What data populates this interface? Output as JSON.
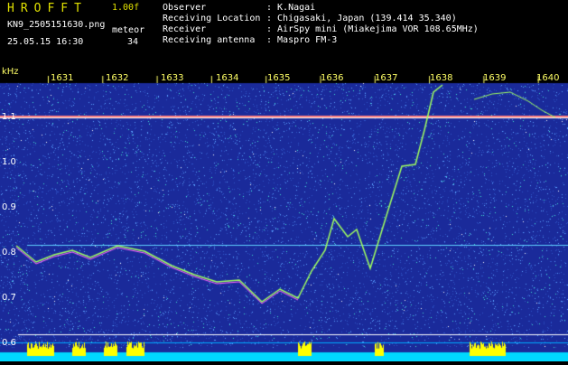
{
  "header": {
    "logo": "HROFFT",
    "version": "1.00f",
    "filename": "KN9_2505151630.png",
    "datetime": "25.05.15 16:30",
    "meteor_label": "meteor",
    "meteor_count": "34",
    "fields": [
      {
        "label": "Observer",
        "value": ": K.Nagai"
      },
      {
        "label": "Receiving Location",
        "value": ": Chigasaki, Japan (139.414 35.340)"
      },
      {
        "label": "Receiver",
        "value": ": AirSpy mini (Miakejima VOR 108.65MHz)"
      },
      {
        "label": "Receiving antenna",
        "value": ": Maspro FM-3"
      }
    ]
  },
  "spectrogram": {
    "y_unit": "kHz",
    "time_ticks": [
      "1631",
      "1632",
      "1633",
      "1634",
      "1635",
      "1636",
      "1637",
      "1638",
      "1639",
      "1640"
    ],
    "freq_ticks": [
      "1.1",
      "1.0",
      "0.9",
      "0.8",
      "0.7",
      "0.6"
    ],
    "colors": {
      "background": "#1a2a9a",
      "noise": "#5aa0ff",
      "carrier": "#ff8080",
      "trace": "#80ff80",
      "baseline": "#00d8ff",
      "burst": "#ffff00"
    }
  }
}
